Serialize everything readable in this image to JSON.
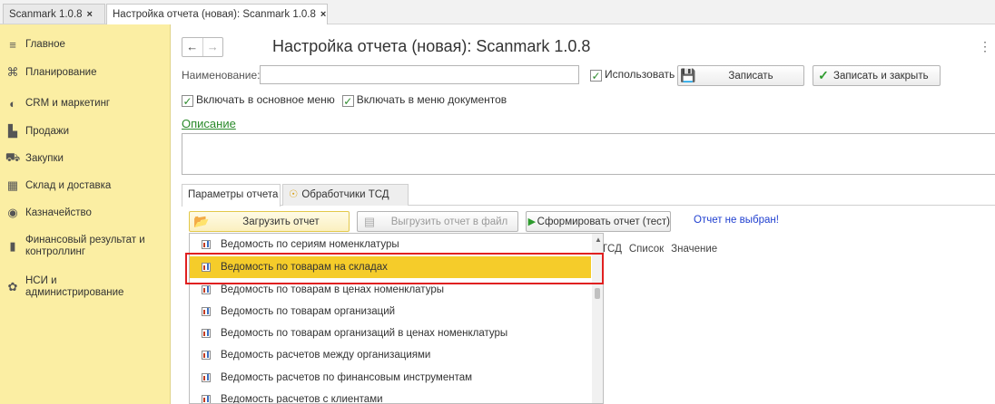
{
  "window_tabs": [
    {
      "label": "Scanmark 1.0.8",
      "close": "×"
    },
    {
      "label": "Настройка отчета (новая): Scanmark 1.0.8",
      "close": "×"
    }
  ],
  "sidebar": {
    "items": [
      {
        "icon": "≡",
        "label": "Главное"
      },
      {
        "icon": "⌘",
        "label": "Планирование"
      },
      {
        "icon": "◐",
        "label": "CRM и маркетинг"
      },
      {
        "icon": "▙",
        "label": "Продажи"
      },
      {
        "icon": "⛟",
        "label": "Закупки"
      },
      {
        "icon": "▦",
        "label": "Склад и доставка"
      },
      {
        "icon": "◉",
        "label": "Казначейство"
      },
      {
        "icon": "▮",
        "label": "Финансовый результат и контроллинг"
      },
      {
        "icon": "✿",
        "label": "НСИ и администрирование"
      }
    ]
  },
  "header": {
    "back": "←",
    "forward": "→",
    "title": "Настройка отчета (новая): Scanmark 1.0.8",
    "more": "⋮"
  },
  "form": {
    "name_label": "Наименование:",
    "name_value": "",
    "use_label": "Использовать",
    "save_label": "Записать",
    "save_close_label": "Записать и закрыть",
    "main_menu_label": "Включать в основное меню",
    "doc_menu_label": "Включать в меню документов",
    "check": "✓",
    "description_link": "Описание"
  },
  "param_tabs": {
    "params": "Параметры отчета",
    "handlers": "Обработчики ТСД"
  },
  "toolbar": {
    "load_label": "Загрузить отчет",
    "export_label": "Выгрузить отчет в файл",
    "run_label": "Сформировать отчет (тест)",
    "status": "Отчет не выбран!"
  },
  "columns": [
    "ТСД",
    "Список",
    "Значение"
  ],
  "dropdown": {
    "selected_index": 1,
    "items": [
      "Ведомость по сериям номенклатуры",
      "Ведомость по товарам на складах",
      "Ведомость по товарам в ценах номенклатуры",
      "Ведомость по товарам организаций",
      "Ведомость по товарам организаций в ценах номенклатуры",
      "Ведомость расчетов между организациями",
      "Ведомость расчетов по финансовым инструментам",
      "Ведомость расчетов с клиентами"
    ]
  },
  "colors": {
    "sidebar_bg": "#fbeea3",
    "selected_bg": "#f5cc2a",
    "highlight_border": "#e02020",
    "link": "#2a8a2a",
    "status": "#1f3fd0"
  }
}
